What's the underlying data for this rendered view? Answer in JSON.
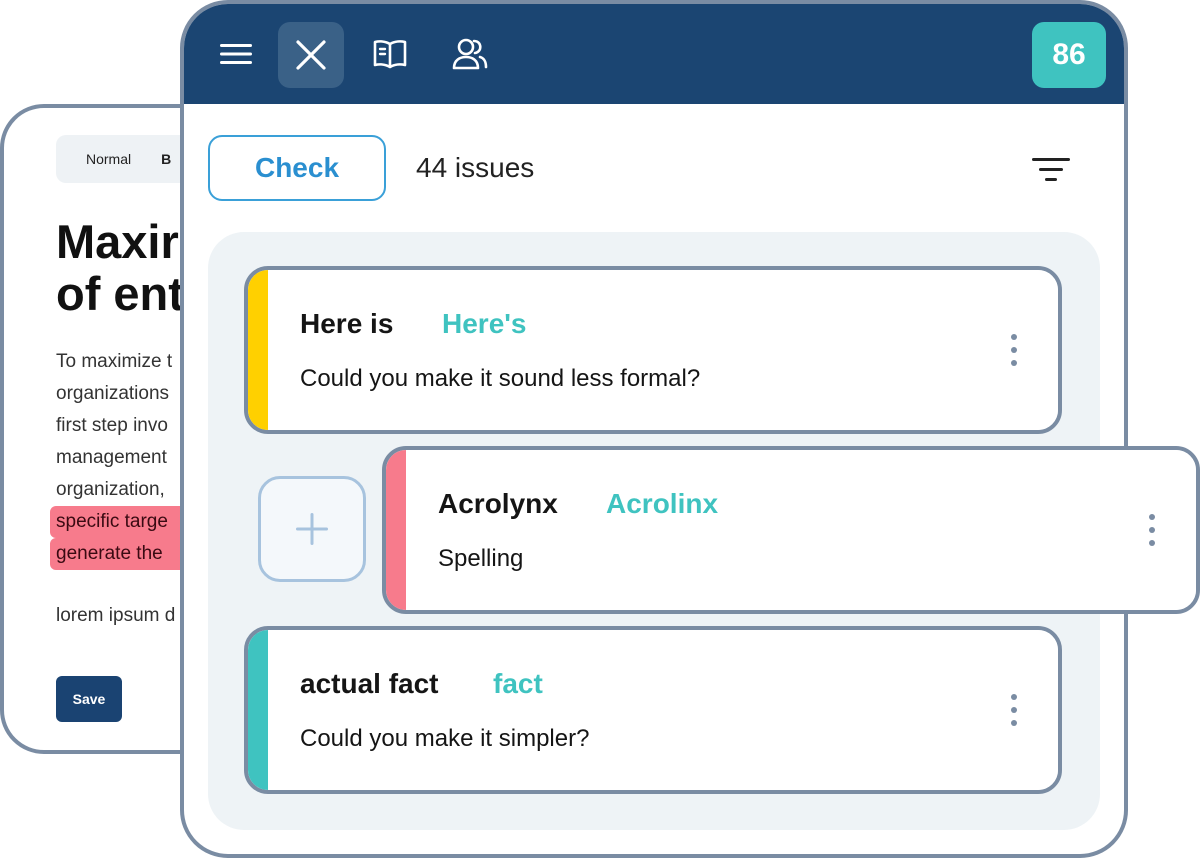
{
  "editor": {
    "toolbar": {
      "style": "Normal",
      "bold": "B"
    },
    "heading_lines": [
      "Maxir",
      "of ent"
    ],
    "paragraph_lines": [
      "To maximize t",
      "organizations",
      "first step invo",
      "management",
      "organization, "
    ],
    "highlighted_lines": [
      "specific targe",
      "generate the "
    ],
    "lorem": "lorem ipsum d",
    "save_label": "Save"
  },
  "sidebar": {
    "topbar": {
      "icons": [
        "menu-icon",
        "acrolinx-logo-icon",
        "book-icon",
        "users-icon"
      ],
      "score": "86"
    },
    "check_label": "Check",
    "issues_count": "44 issues",
    "filter_icon": "filter-icon",
    "add_icon": "plus-icon",
    "cards": [
      {
        "original": "Here is",
        "suggestion": "Here's",
        "hint": "Could you make it sound less formal?",
        "color": "#ffd000"
      },
      {
        "original": "Acrolynx",
        "suggestion": "Acrolinx",
        "hint": "Spelling",
        "color": "#f77b8c"
      },
      {
        "original": "actual fact",
        "suggestion": "fact",
        "hint": "Could you make it simpler?",
        "color": "#3fc3c0"
      }
    ]
  },
  "colors": {
    "topbar": "#1b4572",
    "accent": "#3fc3c0",
    "check": "#2a8fd0",
    "border": "#7a8ca3",
    "highlight": "#f77b8c"
  }
}
